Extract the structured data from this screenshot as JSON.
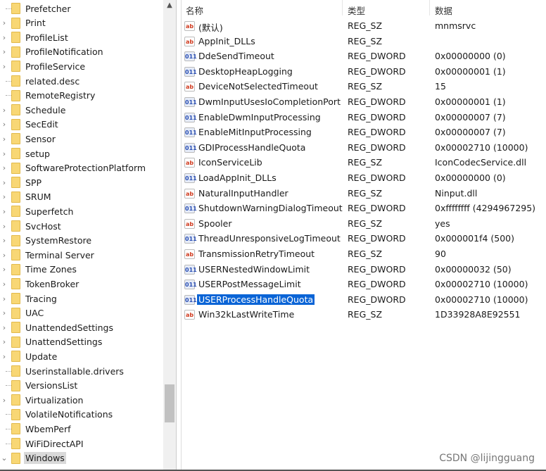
{
  "tree": {
    "items": [
      {
        "label": "Prefetcher",
        "expand": false
      },
      {
        "label": "Print",
        "expand": true
      },
      {
        "label": "ProfileList",
        "expand": true
      },
      {
        "label": "ProfileNotification",
        "expand": true
      },
      {
        "label": "ProfileService",
        "expand": true
      },
      {
        "label": "related.desc",
        "expand": false
      },
      {
        "label": "RemoteRegistry",
        "expand": false
      },
      {
        "label": "Schedule",
        "expand": true
      },
      {
        "label": "SecEdit",
        "expand": true
      },
      {
        "label": "Sensor",
        "expand": true
      },
      {
        "label": "setup",
        "expand": true
      },
      {
        "label": "SoftwareProtectionPlatform",
        "expand": true
      },
      {
        "label": "SPP",
        "expand": true
      },
      {
        "label": "SRUM",
        "expand": true
      },
      {
        "label": "Superfetch",
        "expand": true
      },
      {
        "label": "SvcHost",
        "expand": true
      },
      {
        "label": "SystemRestore",
        "expand": true
      },
      {
        "label": "Terminal Server",
        "expand": true
      },
      {
        "label": "Time Zones",
        "expand": true
      },
      {
        "label": "TokenBroker",
        "expand": true
      },
      {
        "label": "Tracing",
        "expand": true
      },
      {
        "label": "UAC",
        "expand": true
      },
      {
        "label": "UnattendedSettings",
        "expand": true
      },
      {
        "label": "UnattendSettings",
        "expand": true
      },
      {
        "label": "Update",
        "expand": true
      },
      {
        "label": "Userinstallable.drivers",
        "expand": false
      },
      {
        "label": "VersionsList",
        "expand": false
      },
      {
        "label": "Virtualization",
        "expand": true
      },
      {
        "label": "VolatileNotifications",
        "expand": false
      },
      {
        "label": "WbemPerf",
        "expand": false
      },
      {
        "label": "WiFiDirectAPI",
        "expand": false
      },
      {
        "label": "Windows",
        "expand": "open",
        "selected": true
      }
    ]
  },
  "list": {
    "headers": {
      "name": "名称",
      "type": "类型",
      "data": "数据"
    },
    "rows": [
      {
        "name": "(默认)",
        "type": "REG_SZ",
        "data": "mnmsrvc"
      },
      {
        "name": "AppInit_DLLs",
        "type": "REG_SZ",
        "data": ""
      },
      {
        "name": "DdeSendTimeout",
        "type": "REG_DWORD",
        "data": "0x00000000 (0)"
      },
      {
        "name": "DesktopHeapLogging",
        "type": "REG_DWORD",
        "data": "0x00000001 (1)"
      },
      {
        "name": "DeviceNotSelectedTimeout",
        "type": "REG_SZ",
        "data": "15"
      },
      {
        "name": "DwmInputUsesIoCompletionPort",
        "type": "REG_DWORD",
        "data": "0x00000001 (1)"
      },
      {
        "name": "EnableDwmInputProcessing",
        "type": "REG_DWORD",
        "data": "0x00000007 (7)"
      },
      {
        "name": "EnableMitInputProcessing",
        "type": "REG_DWORD",
        "data": "0x00000007 (7)"
      },
      {
        "name": "GDIProcessHandleQuota",
        "type": "REG_DWORD",
        "data": "0x00002710 (10000)"
      },
      {
        "name": "IconServiceLib",
        "type": "REG_SZ",
        "data": "IconCodecService.dll"
      },
      {
        "name": "LoadAppInit_DLLs",
        "type": "REG_DWORD",
        "data": "0x00000000 (0)"
      },
      {
        "name": "NaturalInputHandler",
        "type": "REG_SZ",
        "data": "Ninput.dll"
      },
      {
        "name": "ShutdownWarningDialogTimeout",
        "type": "REG_DWORD",
        "data": "0xffffffff (4294967295)"
      },
      {
        "name": "Spooler",
        "type": "REG_SZ",
        "data": "yes"
      },
      {
        "name": "ThreadUnresponsiveLogTimeout",
        "type": "REG_DWORD",
        "data": "0x000001f4 (500)"
      },
      {
        "name": "TransmissionRetryTimeout",
        "type": "REG_SZ",
        "data": "90"
      },
      {
        "name": "USERNestedWindowLimit",
        "type": "REG_DWORD",
        "data": "0x00000032 (50)"
      },
      {
        "name": "USERPostMessageLimit",
        "type": "REG_DWORD",
        "data": "0x00002710 (10000)"
      },
      {
        "name": "USERProcessHandleQuota",
        "type": "REG_DWORD",
        "data": "0x00002710 (10000)",
        "selected": true
      },
      {
        "name": "Win32kLastWriteTime",
        "type": "REG_SZ",
        "data": "1D33928A8E92551"
      }
    ]
  },
  "watermark": "CSDN @lijingguang",
  "colors": {
    "selection": "#0a64d6",
    "folder": "#f8d775"
  }
}
